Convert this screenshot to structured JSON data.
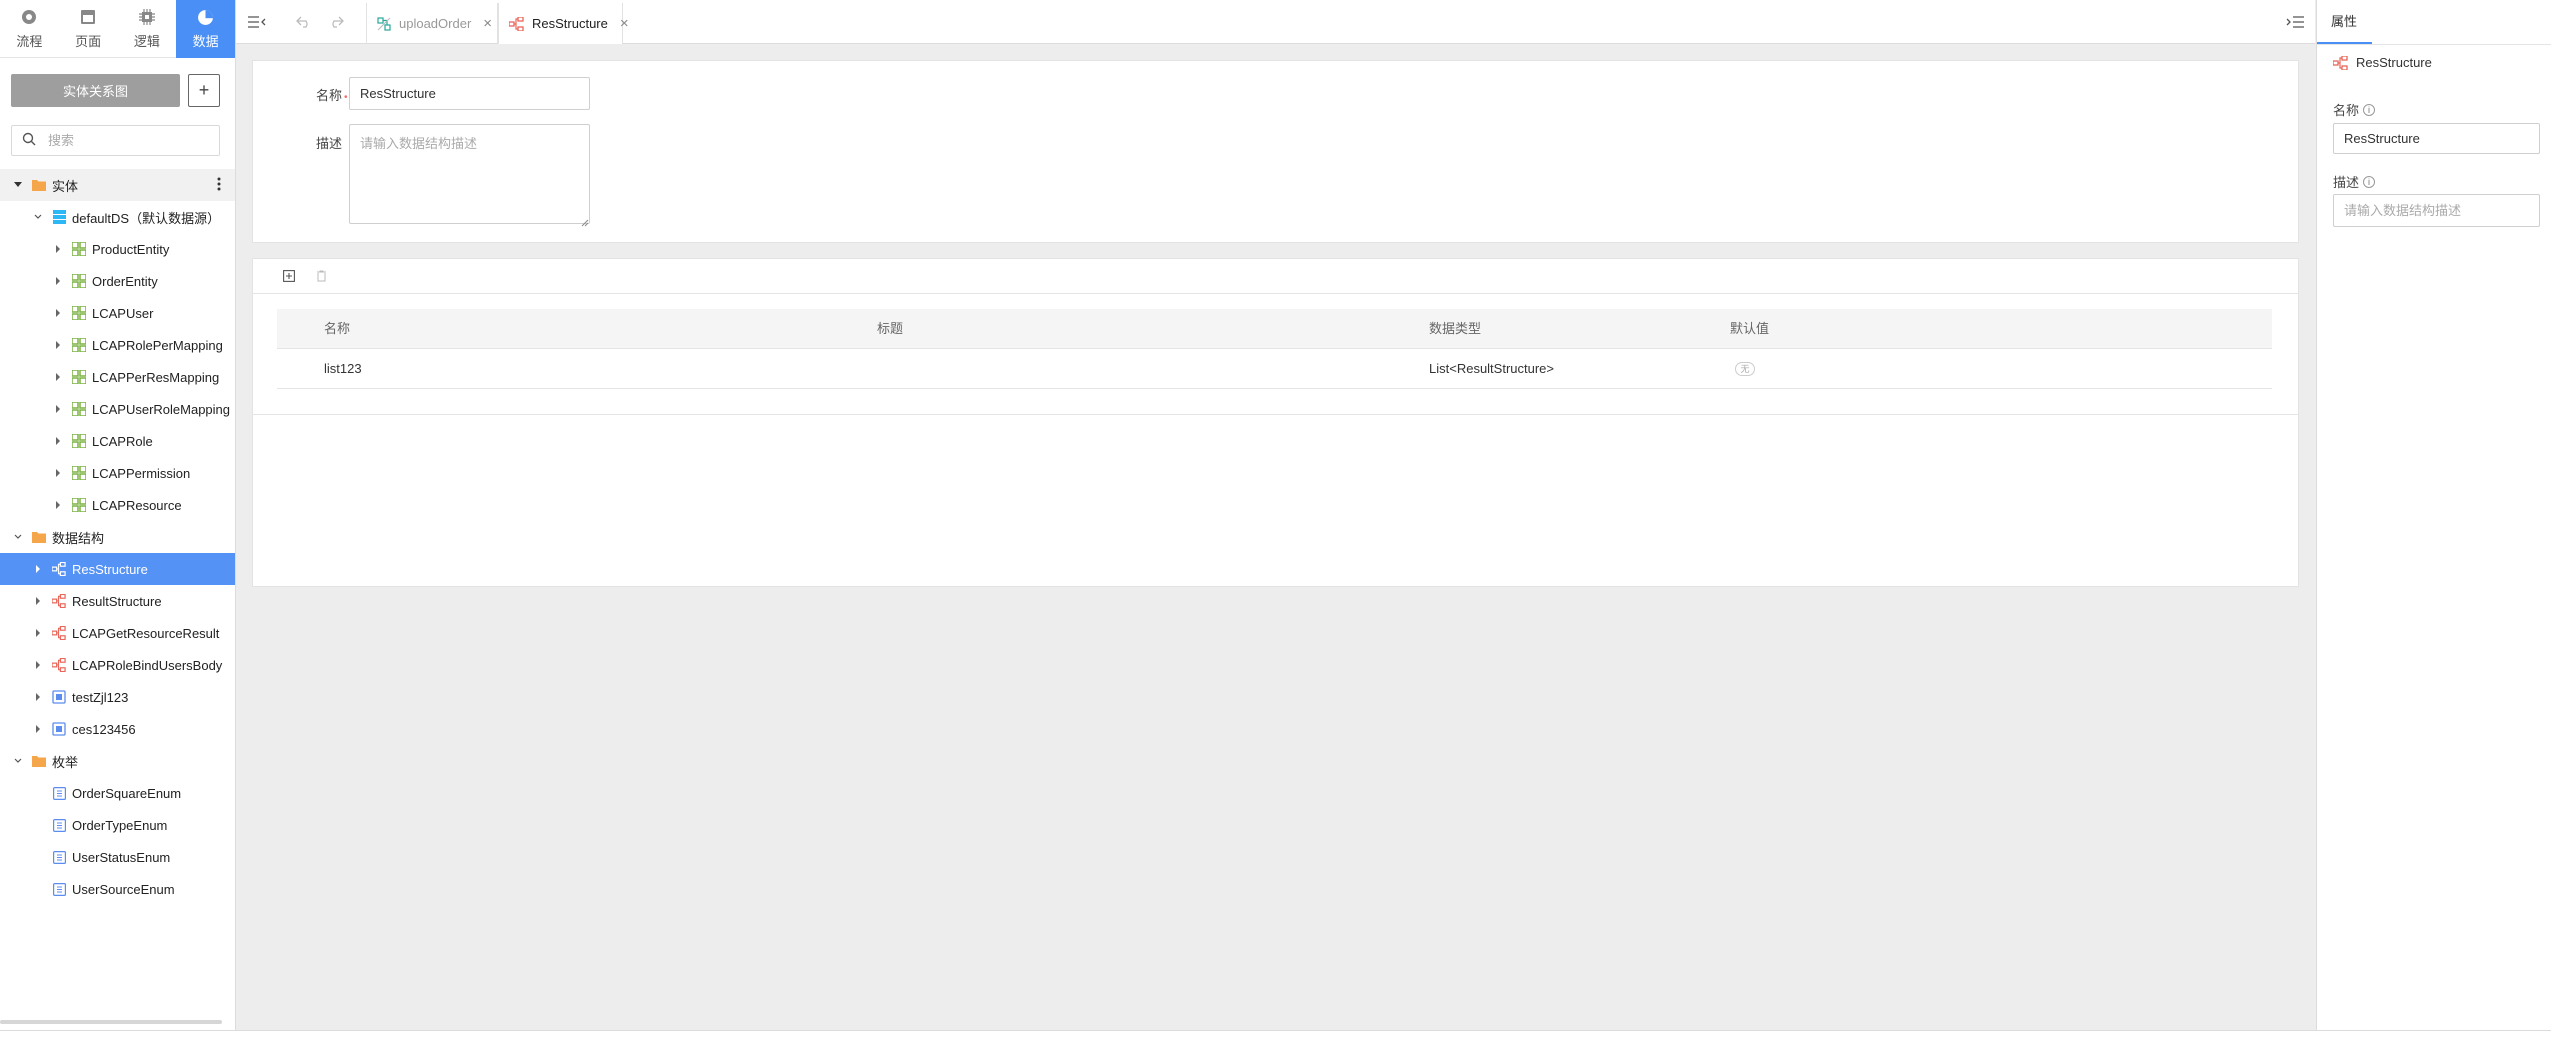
{
  "modes": [
    {
      "label": "流程",
      "icon": "process-icon"
    },
    {
      "label": "页面",
      "icon": "page-icon"
    },
    {
      "label": "逻辑",
      "icon": "logic-icon"
    },
    {
      "label": "数据",
      "icon": "data-pie-icon",
      "active": true
    }
  ],
  "sidebar": {
    "er_button": "实体关系图",
    "add_button": "+",
    "search_placeholder": "搜索"
  },
  "tree": {
    "entities_group": "实体",
    "datasource": "defaultDS（默认数据源）",
    "entities": [
      "ProductEntity",
      "OrderEntity",
      "LCAPUser",
      "LCAPRolePerMapping",
      "LCAPPerResMapping",
      "LCAPUserRoleMapping",
      "LCAPRole",
      "LCAPPermission",
      "LCAPResource"
    ],
    "structures_group": "数据结构",
    "structures": [
      {
        "label": "ResStructure",
        "type": "structure",
        "selected": true
      },
      {
        "label": "ResultStructure",
        "type": "structure"
      },
      {
        "label": "LCAPGetResourceResult",
        "type": "structure"
      },
      {
        "label": "LCAPRoleBindUsersBody",
        "type": "structure"
      },
      {
        "label": "testZjl123",
        "type": "module"
      },
      {
        "label": "ces123456",
        "type": "module"
      }
    ],
    "enums_group": "枚举",
    "enums": [
      "OrderSquareEnum",
      "OrderTypeEnum",
      "UserStatusEnum",
      "UserSourceEnum"
    ]
  },
  "tabs": [
    {
      "label": "uploadOrder",
      "active": false
    },
    {
      "label": "ResStructure",
      "active": true
    }
  ],
  "form": {
    "name_label": "名称",
    "name_value": "ResStructure",
    "desc_label": "描述",
    "desc_placeholder": "请输入数据结构描述"
  },
  "table": {
    "headers": [
      "名称",
      "标题",
      "数据类型",
      "默认值"
    ],
    "rows": [
      {
        "name": "list123",
        "title": "",
        "type": "List<ResultStructure>",
        "default": "无"
      }
    ]
  },
  "props": {
    "tab": "属性",
    "title": "ResStructure",
    "name_label": "名称",
    "name_value": "ResStructure",
    "desc_label": "描述",
    "desc_placeholder": "请输入数据结构描述"
  },
  "colors": {
    "accent": "#4a8ff6",
    "selected_row": "#5592f6",
    "folder": "#f5a64a",
    "entity": "#7cb342",
    "structure": "#e8665a",
    "enum": "#5b8def"
  }
}
